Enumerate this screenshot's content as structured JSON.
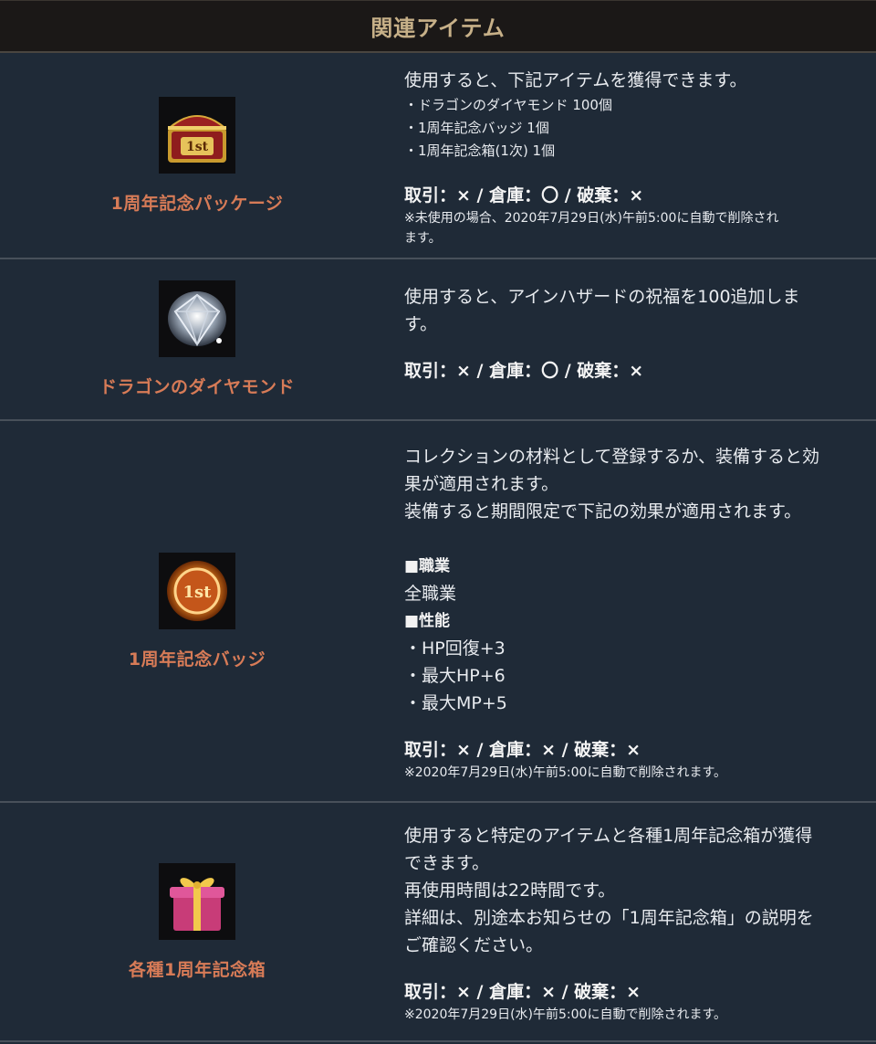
{
  "header": {
    "title": "関連アイテム"
  },
  "items": [
    {
      "name": "1周年記念パッケージ",
      "icon": "treasure-chest-icon",
      "desc": "使用すると、下記アイテムを獲得できます。",
      "bullets": [
        "・ドラゴンのダイヤモンド 100個",
        "・1周年記念バッジ 1個",
        "・1周年記念箱(1次) 1個"
      ],
      "trade": "取引：× / 倉庫：〇 / 破棄：×",
      "note_line1": "※未使用の場合、2020年7月29日(水)午前5:00に自動で削除され",
      "note_line2": "ます。"
    },
    {
      "name": "ドラゴンのダイヤモンド",
      "icon": "diamond-icon",
      "desc_line1": "使用すると、アインハザードの祝福を100追加しま",
      "desc_line2": "す。",
      "trade": "取引：× / 倉庫：〇 / 破棄：×"
    },
    {
      "name": "1周年記念バッジ",
      "icon": "badge-icon",
      "desc_line1": "コレクションの材料として登録するか、装備すると効",
      "desc_line2": "果が適用されます。",
      "desc_line3": "装備すると期間限定で下記の効果が適用されます。",
      "job_heading": "■職業",
      "job_value": "全職業",
      "perf_heading": "■性能",
      "perf": [
        "・HP回復+3",
        "・最大HP+6",
        "・最大MP+5"
      ],
      "trade": "取引：× / 倉庫：× / 破棄：×",
      "note": "※2020年7月29日(水)午前5:00に自動で削除されます。"
    },
    {
      "name": "各種1周年記念箱",
      "icon": "gift-box-icon",
      "desc_line1": "使用すると特定のアイテムと各種1周年記念箱が獲得",
      "desc_line2": "できます。",
      "desc_line3": "再使用時間は22時間です。",
      "desc_line4": "詳細は、別途本お知らせの「1周年記念箱」の説明を",
      "desc_line5": "ご確認ください。",
      "trade": "取引：× / 倉庫：× / 破棄：×",
      "note": "※2020年7月29日(水)午前5:00に自動で削除されます。"
    }
  ],
  "colors": {
    "background": "#1f2a37",
    "header_bg": "#1b1817",
    "header_text": "#c7b088",
    "item_name": "#d77b57",
    "divider": "#48505a"
  }
}
